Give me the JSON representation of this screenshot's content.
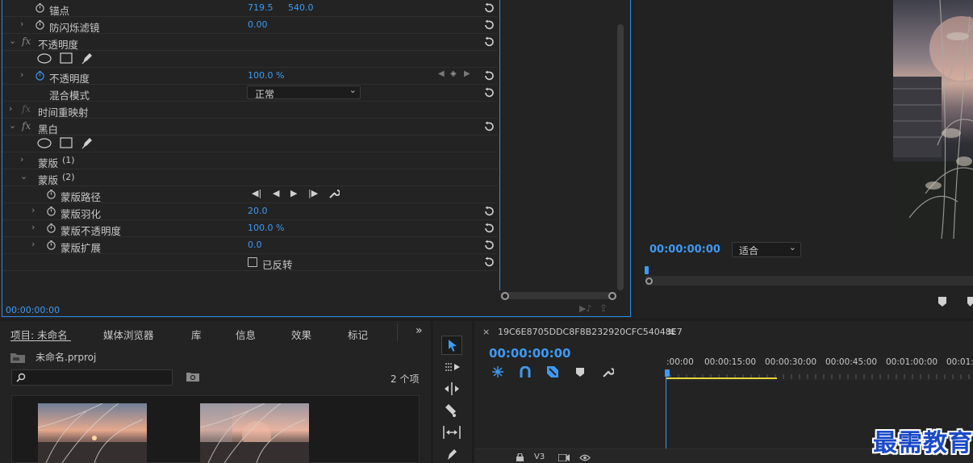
{
  "effect_controls": {
    "rows": [
      {
        "label": "锚点",
        "value": "719.5",
        "value2": "540.0"
      },
      {
        "label": "防闪烁滤镜",
        "value": "0.00"
      },
      {
        "label": "不透明度",
        "fx": "fx"
      },
      {
        "label": "不透明度",
        "value": "100.0 %"
      },
      {
        "label": "混合模式",
        "value": "正常"
      },
      {
        "label": "时间重映射",
        "fx": "fx"
      },
      {
        "label": "黑白",
        "fx": "fx"
      },
      {
        "label": "蒙版",
        "suffix": "(1)"
      },
      {
        "label": "蒙版",
        "suffix": "(2)"
      },
      {
        "label": "蒙版路径"
      },
      {
        "label": "蒙版羽化",
        "value": "20.0"
      },
      {
        "label": "蒙版不透明度",
        "value": "100.0 %"
      },
      {
        "label": "蒙版扩展",
        "value": "0.0"
      },
      {
        "label": "已反转"
      }
    ],
    "time": "00:00:00:00"
  },
  "program_monitor": {
    "time": "00:00:00:00",
    "fit_label": "适合"
  },
  "project_panel": {
    "tabs": [
      "项目: 未命名",
      "媒体浏览器",
      "库",
      "信息",
      "效果",
      "标记"
    ],
    "more": "»",
    "file_name": "未命名.prproj",
    "item_count": "2 个项"
  },
  "timeline": {
    "sequence_name": "19C6E8705DDC8F8B232920CFC54048E7",
    "time": "00:00:00:00",
    "ticks": [
      ":00:00",
      "00:00:15:00",
      "00:00:30:00",
      "00:00:45:00",
      "00:01:00:00",
      "00:01:1"
    ],
    "track_label": "V3"
  },
  "watermark": "最需教育",
  "colors": {
    "accent": "#3e9af3",
    "panel": "#232323",
    "frame": "#2d8ceb",
    "yellow": "#e6d23a"
  }
}
